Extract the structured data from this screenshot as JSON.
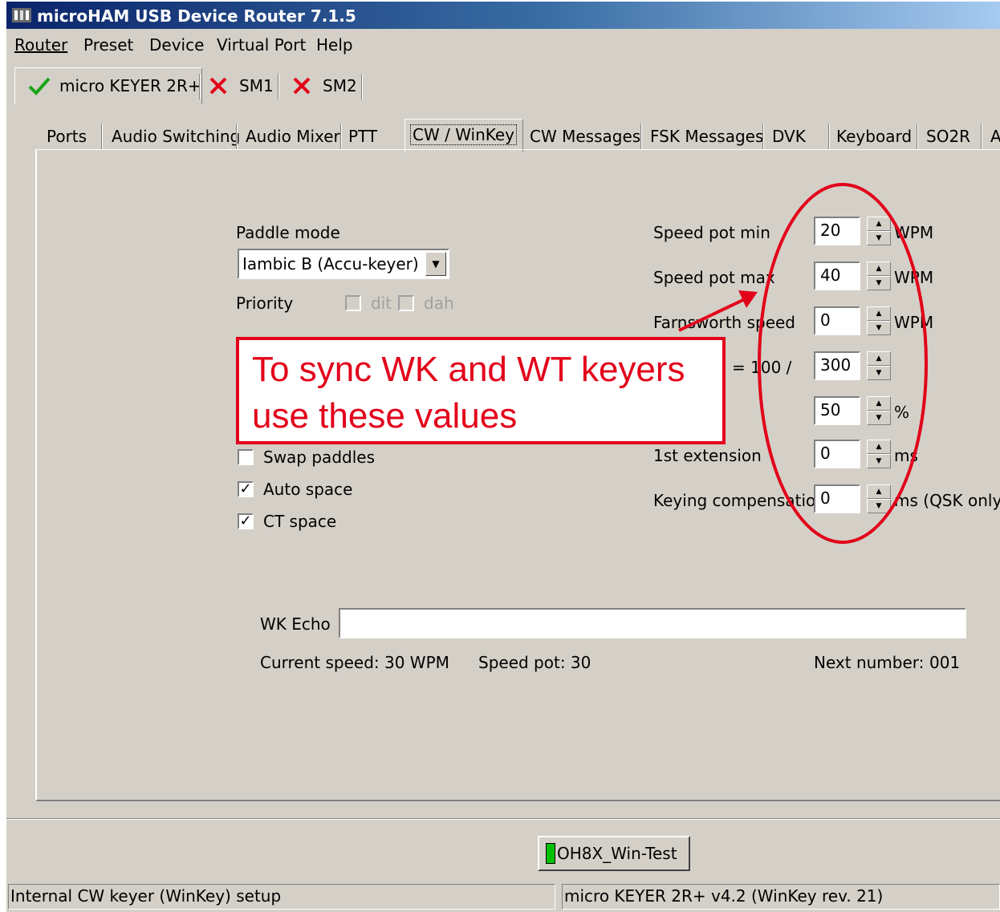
{
  "window": {
    "title": "microHAM USB Device Router 7.1.5",
    "bg_color": "#d4d0c8",
    "title_color": "#0a246a"
  },
  "menu": [
    "Router",
    "Preset",
    "Device",
    "Virtual Port",
    "Help"
  ],
  "device_tabs": [
    {
      "label": "micro KEYER 2R+",
      "status": "check-icon"
    },
    {
      "label": "SM1",
      "status": "x-icon"
    },
    {
      "label": "SM2",
      "status": "x-icon"
    }
  ],
  "sub_tabs": [
    "Ports",
    "Audio Switching",
    "Audio Mixer",
    "PTT",
    "CW / WinKey",
    "CW Messages",
    "FSK Messages",
    "DVK",
    "Keyboard",
    "SO2R",
    "A"
  ],
  "left": {
    "paddle_mode_label": "Paddle mode",
    "paddle_mode_value": "Iambic B  (Accu-keyer)",
    "priority_label": "Priority",
    "dit_label": "dit",
    "dah_label": "dah",
    "swap_paddles": {
      "label": "Swap paddles",
      "checked": false
    },
    "auto_space": {
      "label": "Auto space",
      "checked": true
    },
    "ct_space": {
      "label": "CT space",
      "checked": true
    }
  },
  "right": {
    "speed_pot_min": {
      "label": "Speed pot min",
      "value": "20",
      "unit": "WPM"
    },
    "speed_pot_max": {
      "label": "Speed pot max",
      "value": "40",
      "unit": "WPM"
    },
    "farnsworth": {
      "label": "Farnsworth speed",
      "value": "0",
      "unit": "WPM"
    },
    "ratio": {
      "label": "=  100 /",
      "value": "300"
    },
    "weight": {
      "value": "50",
      "unit": "%"
    },
    "first_ext": {
      "label": "1st extension",
      "value": "0",
      "unit": "ms"
    },
    "keying_comp": {
      "label": "Keying compensation",
      "value": "0",
      "unit": "ms (QSK only)"
    }
  },
  "annotation": {
    "line1": "To sync WK and WT keyers",
    "line2": "use these values",
    "color": "#e2001a"
  },
  "wk_echo_label": "WK Echo",
  "wk_echo_value": "",
  "current_speed": "Current speed: 30 WPM",
  "speed_pot": "Speed pot: 30",
  "next_number_label": "Next number:",
  "next_number_value": "001",
  "router_button": "OH8X_Win-Test",
  "status_left": "Internal CW keyer (WinKey) setup",
  "status_right": "micro KEYER 2R+ v4.2 (WinKey rev. 21)"
}
